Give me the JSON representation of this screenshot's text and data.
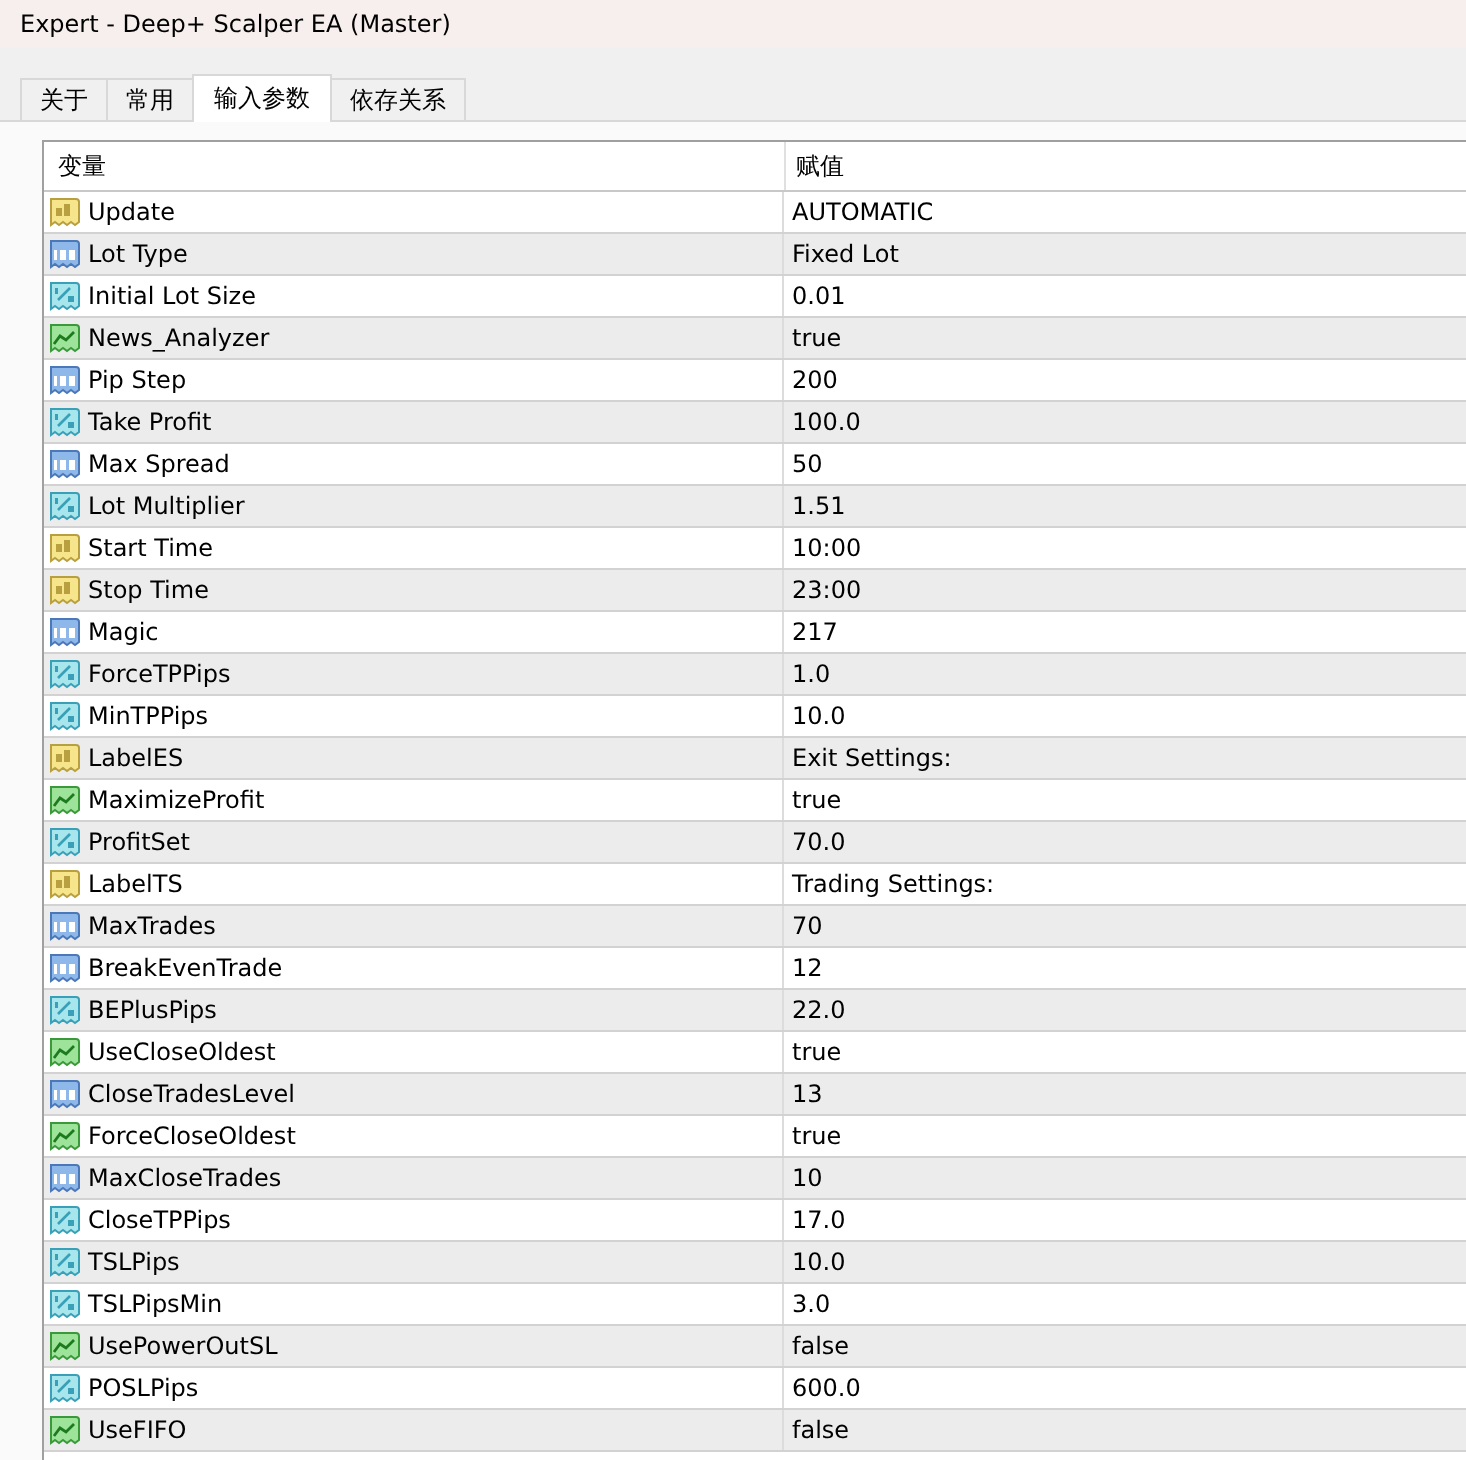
{
  "window": {
    "title": "Expert - Deep+ Scalper EA (Master)"
  },
  "tabs": [
    {
      "label": "关于",
      "selected": false
    },
    {
      "label": "常用",
      "selected": false
    },
    {
      "label": "输入参数",
      "selected": true
    },
    {
      "label": "依存关系",
      "selected": false
    }
  ],
  "table": {
    "columns": [
      "变量",
      "赋值"
    ],
    "rows": [
      {
        "kind": "string",
        "name": "Update",
        "value": "AUTOMATIC"
      },
      {
        "kind": "int",
        "name": "Lot Type",
        "value": "Fixed Lot"
      },
      {
        "kind": "double",
        "name": "Initial Lot Size",
        "value": "0.01"
      },
      {
        "kind": "bool",
        "name": "News_Analyzer",
        "value": "true"
      },
      {
        "kind": "int",
        "name": "Pip Step",
        "value": "200"
      },
      {
        "kind": "double",
        "name": "Take Profit",
        "value": "100.0"
      },
      {
        "kind": "int",
        "name": "Max Spread",
        "value": "50"
      },
      {
        "kind": "double",
        "name": "Lot Multiplier",
        "value": "1.51"
      },
      {
        "kind": "string",
        "name": "Start Time",
        "value": "10:00"
      },
      {
        "kind": "string",
        "name": "Stop Time",
        "value": "23:00"
      },
      {
        "kind": "int",
        "name": "Magic",
        "value": "217"
      },
      {
        "kind": "double",
        "name": "ForceTPPips",
        "value": "1.0"
      },
      {
        "kind": "double",
        "name": "MinTPPips",
        "value": "10.0"
      },
      {
        "kind": "string",
        "name": "LabelES",
        "value": "Exit Settings:"
      },
      {
        "kind": "bool",
        "name": "MaximizeProfit",
        "value": "true"
      },
      {
        "kind": "double",
        "name": "ProfitSet",
        "value": "70.0"
      },
      {
        "kind": "string",
        "name": "LabelTS",
        "value": "Trading Settings:"
      },
      {
        "kind": "int",
        "name": "MaxTrades",
        "value": "70"
      },
      {
        "kind": "int",
        "name": "BreakEvenTrade",
        "value": "12"
      },
      {
        "kind": "double",
        "name": "BEPlusPips",
        "value": "22.0"
      },
      {
        "kind": "bool",
        "name": "UseCloseOldest",
        "value": "true"
      },
      {
        "kind": "int",
        "name": "CloseTradesLevel",
        "value": "13"
      },
      {
        "kind": "bool",
        "name": "ForceCloseOldest",
        "value": "true"
      },
      {
        "kind": "int",
        "name": "MaxCloseTrades",
        "value": "10"
      },
      {
        "kind": "double",
        "name": "CloseTPPips",
        "value": "17.0"
      },
      {
        "kind": "double",
        "name": "TSLPips",
        "value": "10.0"
      },
      {
        "kind": "double",
        "name": "TSLPipsMin",
        "value": "3.0"
      },
      {
        "kind": "bool",
        "name": "UsePowerOutSL",
        "value": "false"
      },
      {
        "kind": "double",
        "name": "POSLPips",
        "value": "600.0"
      },
      {
        "kind": "bool",
        "name": "UseFIFO",
        "value": "false"
      }
    ]
  }
}
